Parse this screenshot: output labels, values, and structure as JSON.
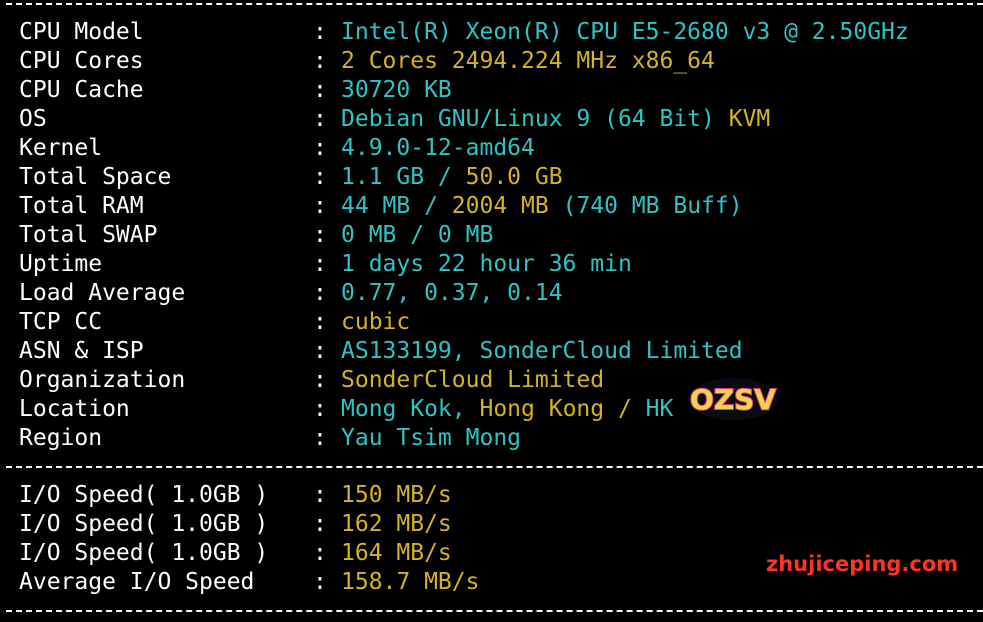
{
  "system_info": [
    {
      "label": "CPU Model",
      "parts": [
        {
          "text": "Intel(R) Xeon(R) CPU E5-2680 v3 @ 2.50GHz",
          "color": "cyan"
        }
      ]
    },
    {
      "label": "CPU Cores",
      "parts": [
        {
          "text": "2 Cores 2494.224 MHz x86_64",
          "color": "yellow"
        }
      ]
    },
    {
      "label": "CPU Cache",
      "parts": [
        {
          "text": "30720 KB",
          "color": "cyan"
        }
      ]
    },
    {
      "label": "OS",
      "parts": [
        {
          "text": "Debian GNU/Linux 9 (64 Bit) ",
          "color": "cyan"
        },
        {
          "text": "KVM",
          "color": "yellow"
        }
      ]
    },
    {
      "label": "Kernel",
      "parts": [
        {
          "text": "4.9.0-12-amd64",
          "color": "cyan"
        }
      ]
    },
    {
      "label": "Total Space",
      "parts": [
        {
          "text": "1.1 GB / ",
          "color": "cyan"
        },
        {
          "text": "50.0 GB",
          "color": "yellow"
        }
      ]
    },
    {
      "label": "Total RAM",
      "parts": [
        {
          "text": "44 MB / ",
          "color": "cyan"
        },
        {
          "text": "2004 MB",
          "color": "yellow"
        },
        {
          "text": " (740 MB Buff)",
          "color": "cyan"
        }
      ]
    },
    {
      "label": "Total SWAP",
      "parts": [
        {
          "text": "0 MB / 0 MB",
          "color": "cyan"
        }
      ]
    },
    {
      "label": "Uptime",
      "parts": [
        {
          "text": "1 days 22 hour 36 min",
          "color": "cyan"
        }
      ]
    },
    {
      "label": "Load Average",
      "parts": [
        {
          "text": "0.77, 0.37, 0.14",
          "color": "cyan"
        }
      ]
    },
    {
      "label": "TCP CC",
      "parts": [
        {
          "text": "cubic",
          "color": "yellow"
        }
      ]
    },
    {
      "label": "ASN & ISP",
      "parts": [
        {
          "text": "AS133199, SonderCloud Limited",
          "color": "cyan"
        }
      ]
    },
    {
      "label": "Organization",
      "parts": [
        {
          "text": "SonderCloud Limited",
          "color": "yellow"
        }
      ]
    },
    {
      "label": "Location",
      "parts": [
        {
          "text": "Mong Kok, ",
          "color": "cyan"
        },
        {
          "text": "Hong Kong / ",
          "color": "yellow"
        },
        {
          "text": "HK",
          "color": "cyan"
        }
      ]
    },
    {
      "label": "Region",
      "parts": [
        {
          "text": "Yau Tsim Mong",
          "color": "cyan"
        }
      ]
    }
  ],
  "io_info": [
    {
      "label": "I/O Speed( 1.0GB )",
      "parts": [
        {
          "text": "150 MB/s",
          "color": "yellow"
        }
      ]
    },
    {
      "label": "I/O Speed( 1.0GB )",
      "parts": [
        {
          "text": "162 MB/s",
          "color": "yellow"
        }
      ]
    },
    {
      "label": "I/O Speed( 1.0GB )",
      "parts": [
        {
          "text": "164 MB/s",
          "color": "yellow"
        }
      ]
    },
    {
      "label": "Average I/O Speed",
      "parts": [
        {
          "text": "158.7 MB/s",
          "color": "yellow"
        }
      ]
    }
  ],
  "separator": ":",
  "watermark": {
    "logo_text": "OZSV",
    "site": "zhujiceping.com"
  },
  "colors": {
    "background": "#000000",
    "label": "#ffffff",
    "cyan": "#2ec4c4",
    "yellow": "#d2b324",
    "watermark_red": "#ff3322"
  }
}
